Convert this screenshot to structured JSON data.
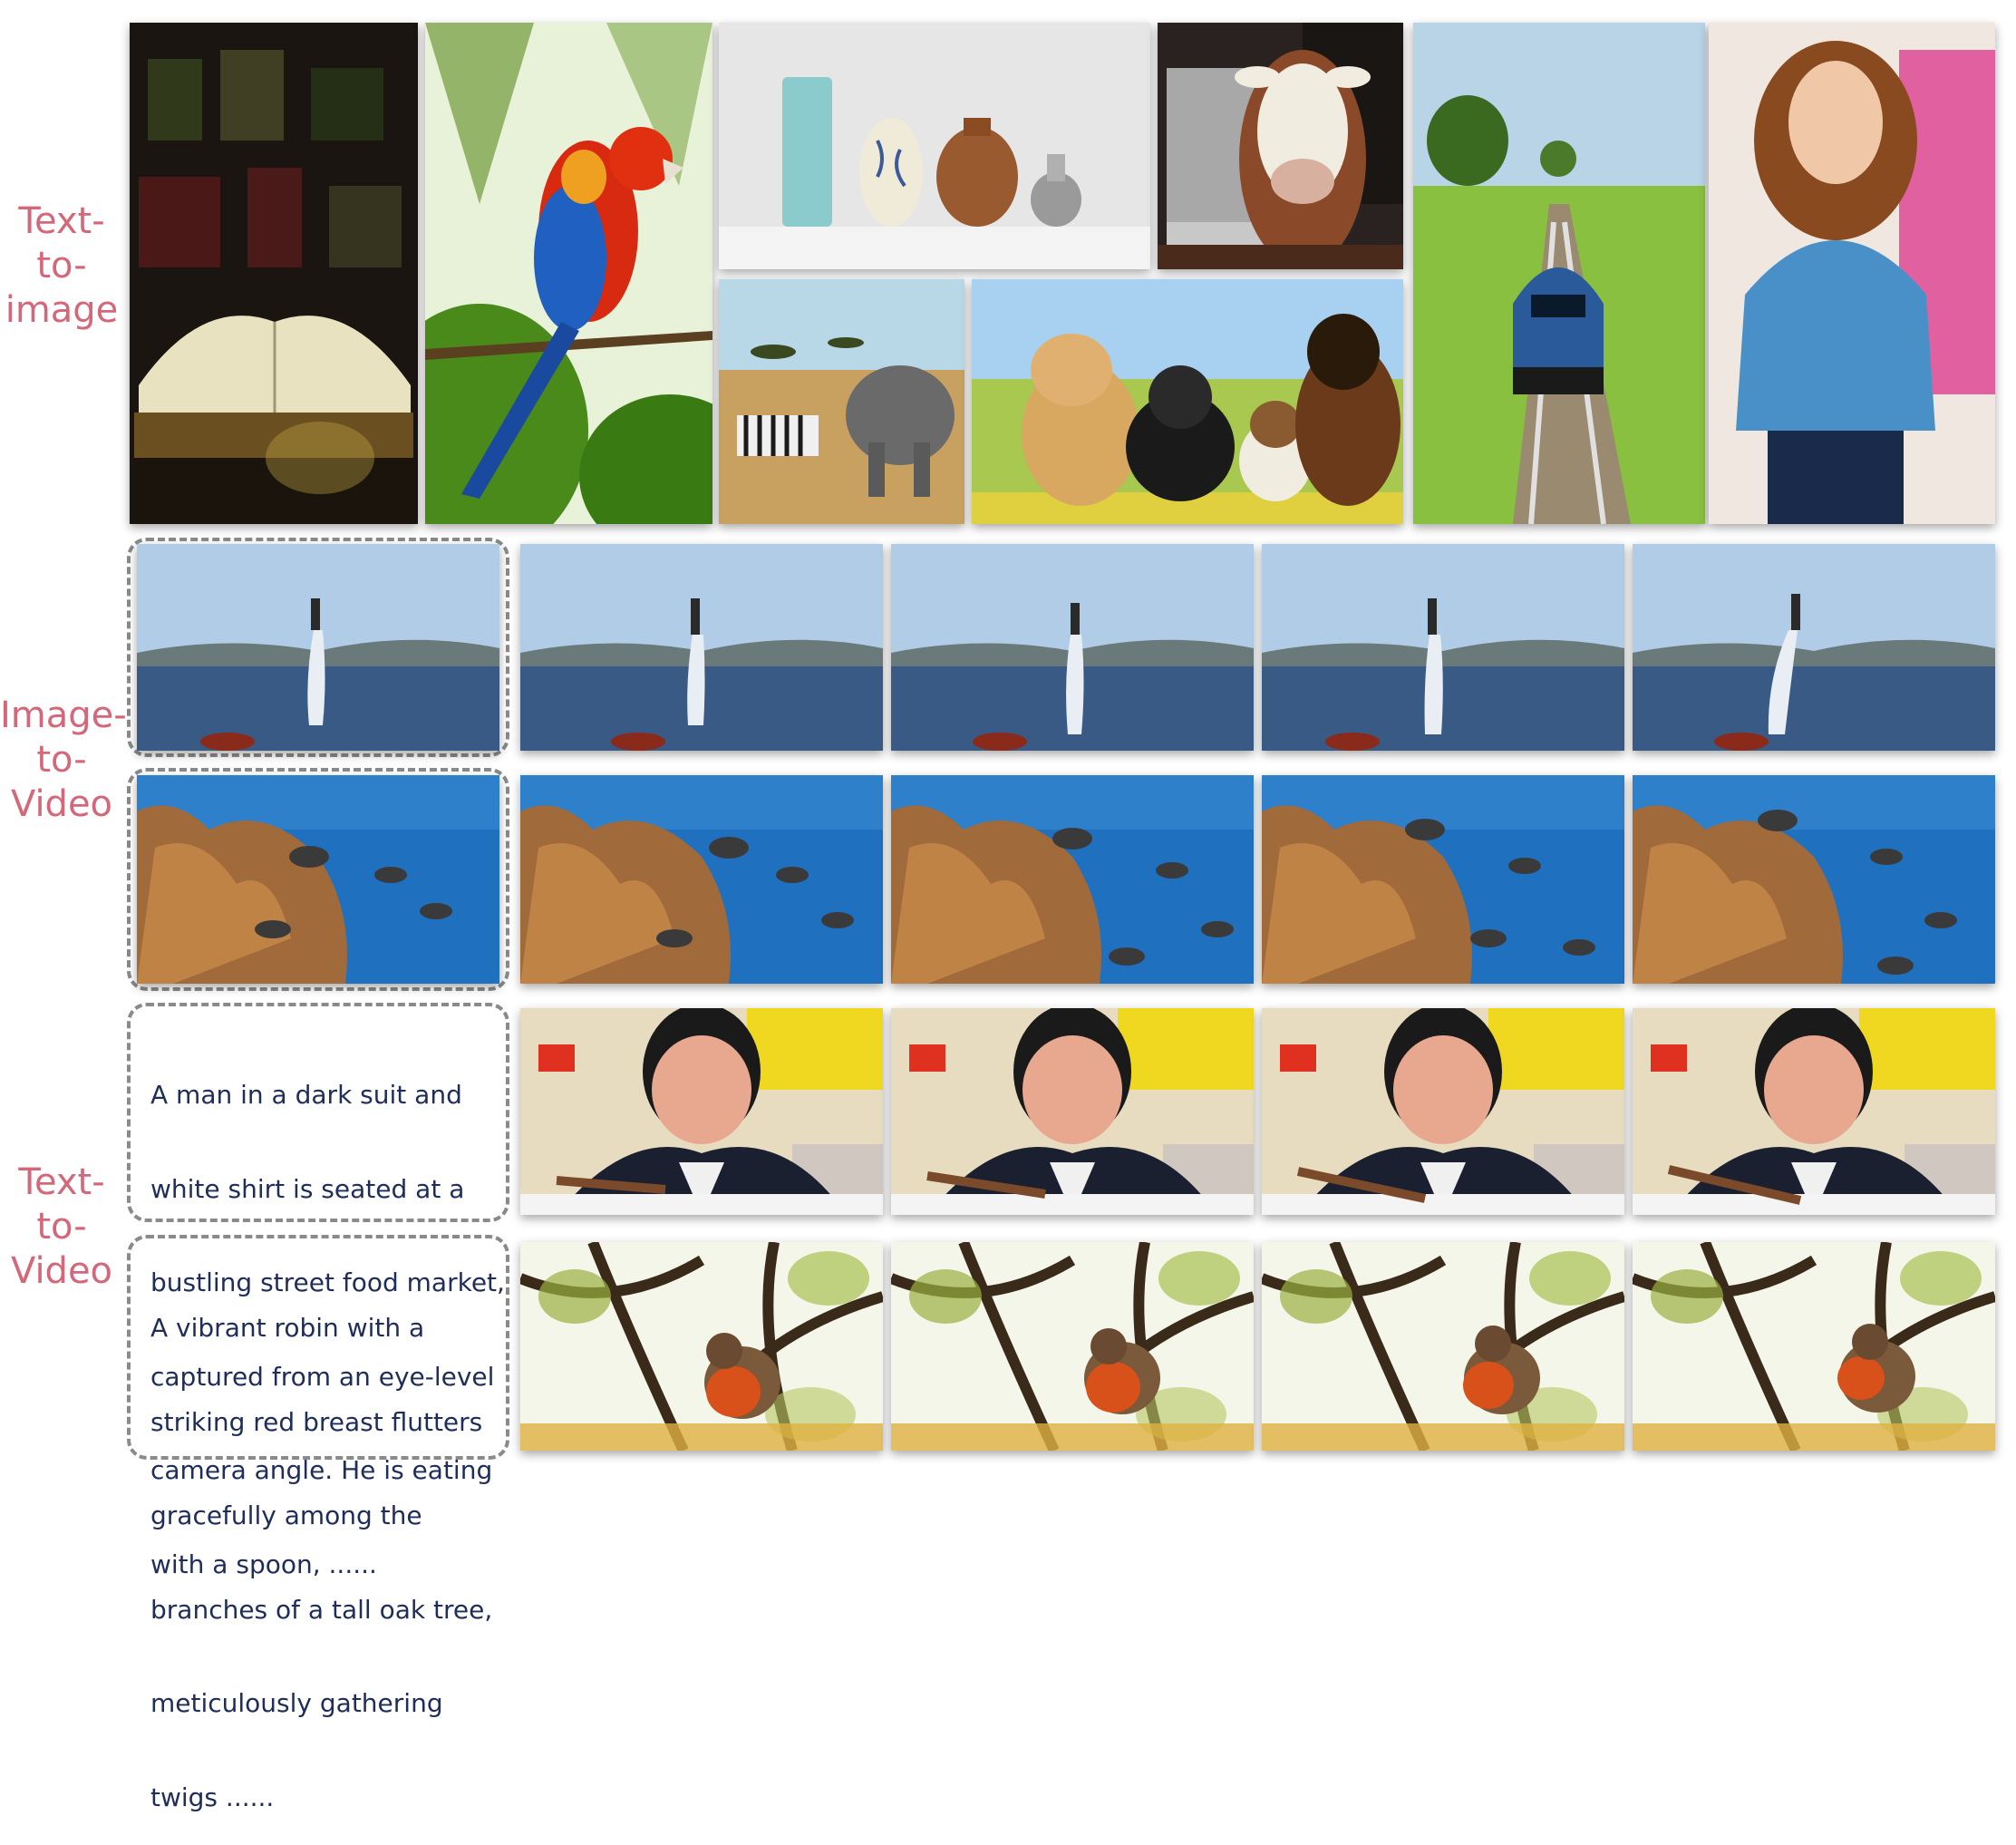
{
  "row_labels": {
    "t2i": [
      "Text-",
      "to-",
      "image"
    ],
    "i2v": [
      "Image-",
      "to-",
      "Video"
    ],
    "t2v": [
      "Text-",
      "to-",
      "Video"
    ]
  },
  "prompts": {
    "man": [
      "A man in a dark suit and",
      "white shirt is seated at a",
      "bustling street food market,",
      "captured from an eye-level",
      "camera angle. He is eating",
      "with a spoon, ......"
    ],
    "robin": [
      "A vibrant robin with a",
      "striking red breast flutters",
      "gracefully among the",
      "branches of a tall oak tree,",
      "meticulously gathering",
      "twigs ......"
    ]
  },
  "colors": {
    "label": "#d4687a",
    "prompt_text": "#1f2d5a",
    "dashed_border": "#8a8a8a"
  }
}
